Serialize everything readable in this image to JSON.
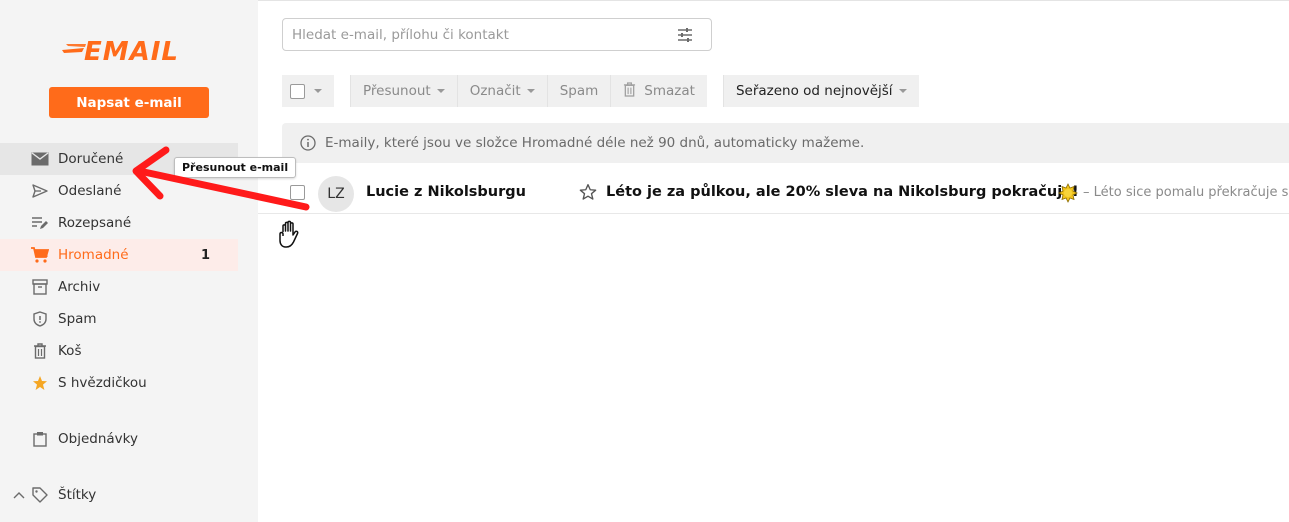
{
  "app": {
    "logo_text": "EMAIL",
    "brand_color": "#ff6b1a"
  },
  "sidebar": {
    "compose_label": "Napsat e-mail",
    "items": [
      {
        "label": "Doručené",
        "icon": "envelope-icon"
      },
      {
        "label": "Odeslané",
        "icon": "send-icon"
      },
      {
        "label": "Rozepsané",
        "icon": "draft-icon"
      },
      {
        "label": "Hromadné",
        "icon": "cart-icon",
        "count": "1"
      },
      {
        "label": "Archiv",
        "icon": "archive-icon"
      },
      {
        "label": "Spam",
        "icon": "shield-icon"
      },
      {
        "label": "Koš",
        "icon": "trash-icon"
      },
      {
        "label": "S hvězdičkou",
        "icon": "star-icon"
      },
      {
        "label": "Objednávky",
        "icon": "clipboard-icon"
      },
      {
        "label": "Štítky",
        "icon": "tag-icon"
      }
    ]
  },
  "search": {
    "placeholder": "Hledat e-mail, přílohu či kontakt"
  },
  "toolbar": {
    "move_label": "Přesunout",
    "mark_label": "Označit",
    "spam_label": "Spam",
    "delete_label": "Smazat",
    "sort_label": "Seřazeno od nejnovější"
  },
  "info": {
    "text": "E-maily, které jsou ve složce Hromadné déle než 90 dnů, automaticky mažeme."
  },
  "emails": [
    {
      "initials": "LZ",
      "sender": "Lucie z Nikolsburgu",
      "subject": "Léto je za půlkou, ale 20% sleva na Nikolsburg pokračuje!",
      "preview": "– Léto sice pomalu překračuje s"
    }
  ],
  "tooltip": {
    "text": "Přesunout e-mail"
  },
  "overlay": {
    "arrow_color": "#ff1a1a"
  }
}
